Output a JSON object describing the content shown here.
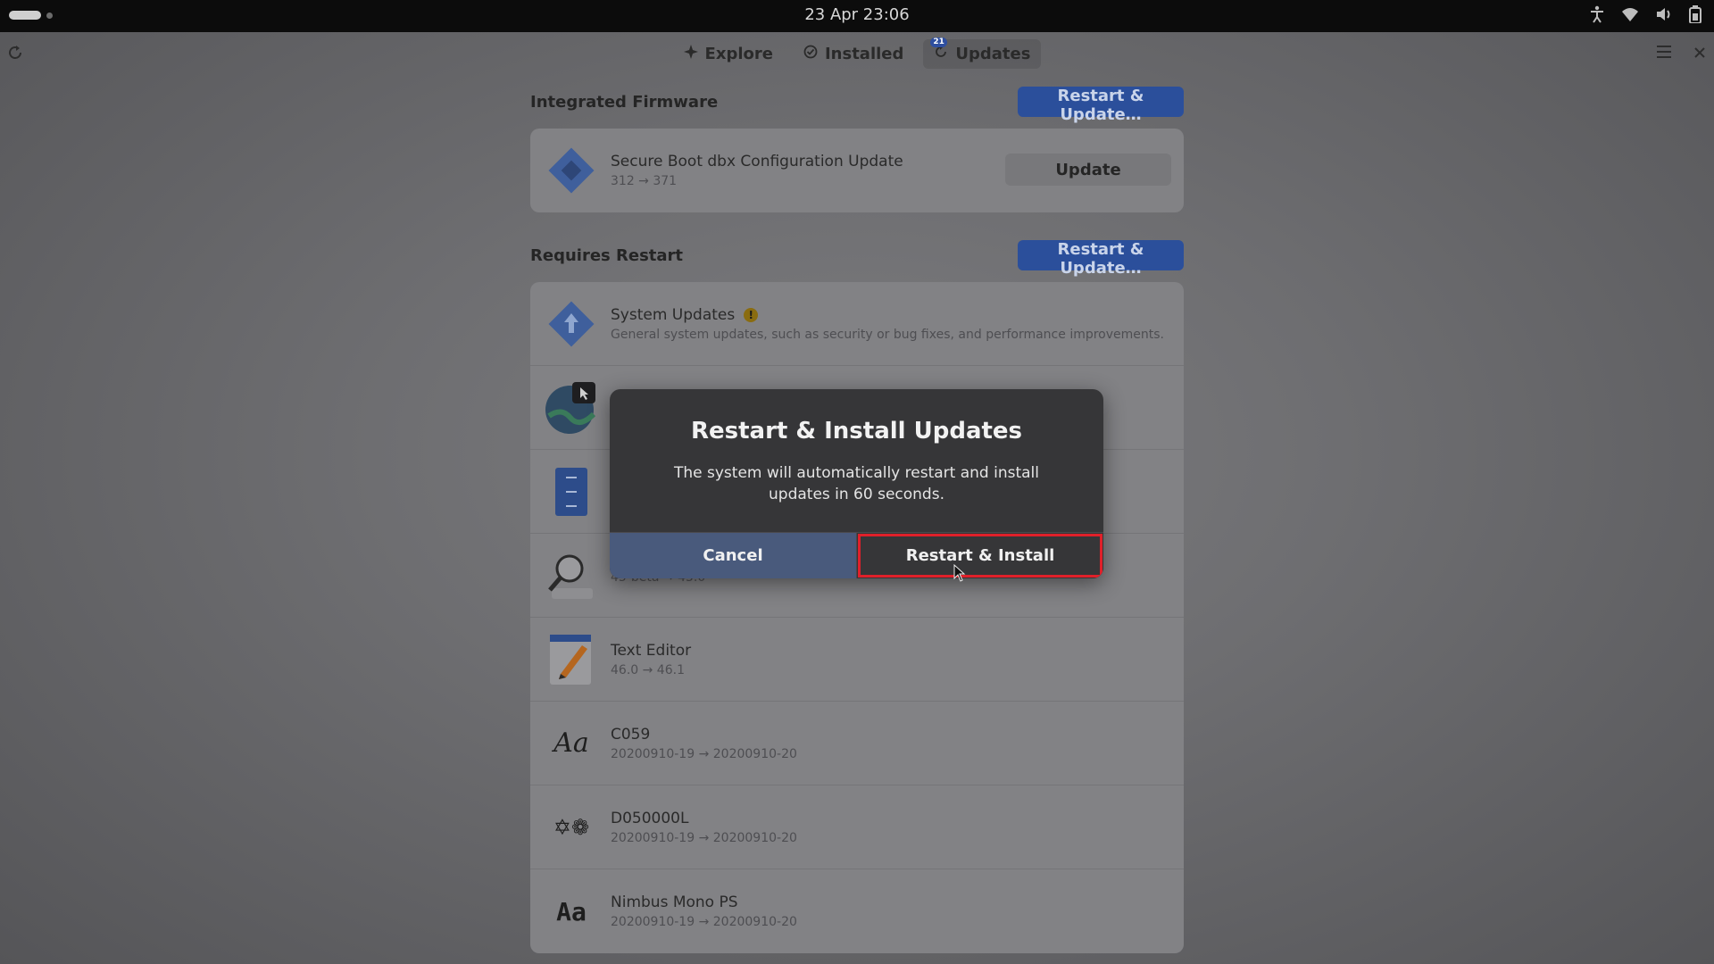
{
  "topbar": {
    "clock": "23 Apr  23:06"
  },
  "header": {
    "tabs": [
      {
        "label": "Explore",
        "icon": "star-icon"
      },
      {
        "label": "Installed",
        "icon": "check-circle-icon"
      },
      {
        "label": "Updates",
        "icon": "update-icon",
        "badge": "21",
        "active": true
      }
    ]
  },
  "sections": {
    "firmware": {
      "title": "Integrated Firmware",
      "action_label": "Restart & Update…",
      "item": {
        "name": "Secure Boot dbx Configuration Update",
        "version": "312 → 371",
        "button_label": "Update"
      }
    },
    "restart": {
      "title": "Requires Restart",
      "action_label": "Restart & Update…",
      "items": [
        {
          "name": "System Updates",
          "version": "General system updates, such as security or bug fixes, and performance improvements.",
          "icon": "system-update-icon"
        },
        {
          "name": "",
          "version": "",
          "icon": "maps-icon"
        },
        {
          "name": "",
          "version": "",
          "icon": "file-cabinet-icon"
        },
        {
          "name": "",
          "version": "45-beta → 45.0",
          "icon": "magnifier-icon"
        },
        {
          "name": "Text Editor",
          "version": "46.0 → 46.1",
          "icon": "text-editor-icon"
        },
        {
          "name": "C059",
          "version": "20200910-19 → 20200910-20",
          "icon": "font-serif-icon",
          "glyph": "Aa"
        },
        {
          "name": "D050000L",
          "version": "20200910-19 → 20200910-20",
          "icon": "font-dingbat-icon",
          "glyph": "✡❁"
        },
        {
          "name": "Nimbus Mono PS",
          "version": "20200910-19 → 20200910-20",
          "icon": "font-mono-icon",
          "glyph": "Aa"
        }
      ]
    }
  },
  "dialog": {
    "title": "Restart & Install Updates",
    "body": "The system will automatically restart and install updates in 60 seconds.",
    "cancel_label": "Cancel",
    "confirm_label": "Restart & Install"
  },
  "colors": {
    "accent": "#2b4f9b",
    "highlight": "#e0202a",
    "warning": "#8a6c10"
  }
}
